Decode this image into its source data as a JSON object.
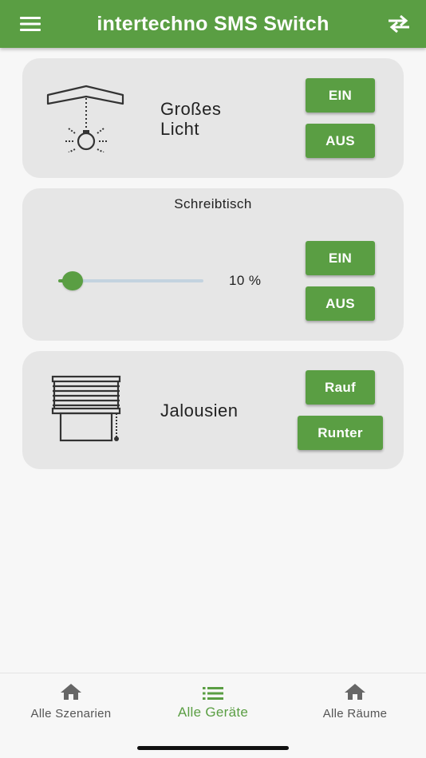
{
  "appbar": {
    "title": "intertechno SMS Switch",
    "menu_icon": "menu-icon",
    "swap_icon": "swap-horizontal-icon"
  },
  "devices": [
    {
      "name": "Großes Licht",
      "icon": "ceiling-lamp-icon",
      "buttons": [
        "EIN",
        "AUS"
      ]
    },
    {
      "name": "Schreibtisch",
      "dimmer_percent": 10,
      "dimmer_label": "10 %",
      "buttons": [
        "EIN",
        "AUS"
      ]
    },
    {
      "name": "Jalousien",
      "icon": "window-blinds-icon",
      "buttons": [
        "Rauf",
        "Runter"
      ]
    }
  ],
  "bottom_nav": {
    "items": [
      {
        "label": "Alle Szenarien",
        "icon": "home-icon",
        "active": false
      },
      {
        "label": "Alle Geräte",
        "icon": "list-icon",
        "active": true
      },
      {
        "label": "Alle Räume",
        "icon": "home-icon",
        "active": false
      }
    ]
  },
  "colors": {
    "accent": "#5a9e43",
    "card_background": "#e6e6e6",
    "page_background": "#f7f7f7",
    "slider_track": "#c3d3df",
    "nav_inactive": "#555555"
  }
}
